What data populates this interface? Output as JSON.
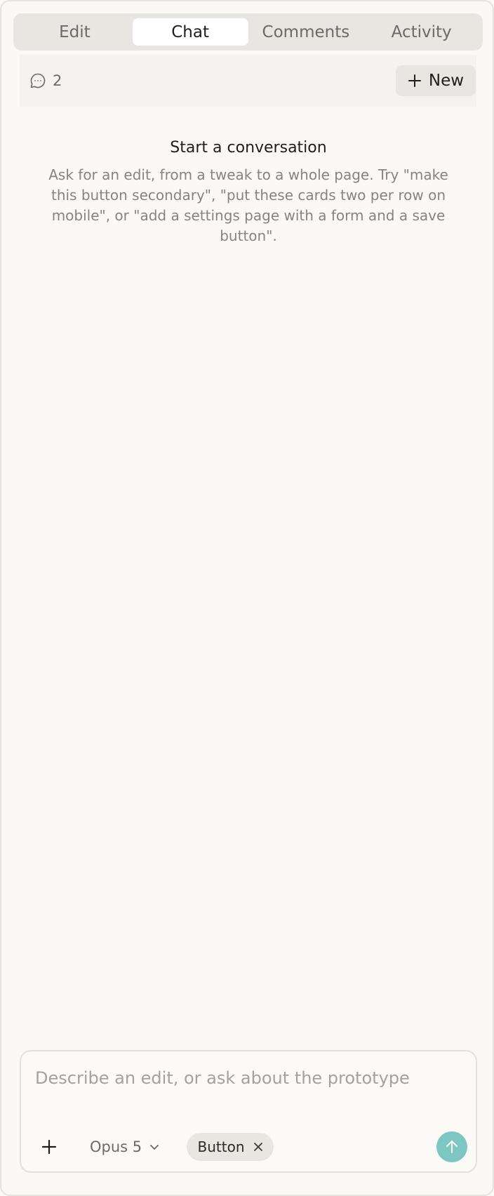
{
  "tabs": [
    {
      "label": "Edit",
      "active": false
    },
    {
      "label": "Chat",
      "active": true
    },
    {
      "label": "Comments",
      "active": false
    },
    {
      "label": "Activity",
      "active": false
    }
  ],
  "subheader": {
    "conversation_count": "2",
    "new_label": "New"
  },
  "empty_state": {
    "title": "Start a conversation",
    "body": "Ask for an edit, from a tweak to a whole page. Try \"make this button secondary\", \"put these cards two per row on mobile\", or \"add a settings page with a form and a save button\"."
  },
  "composer": {
    "placeholder": "Describe an edit, or ask about the prototype",
    "value": "",
    "model_label": "Opus 5",
    "chip_label": "Button"
  },
  "colors": {
    "accent": "#7ec6c1",
    "tab_bg": "#e8e6e0",
    "background": "#faf9f6"
  },
  "icons": {
    "count": "speech-bubble-icon",
    "new": "plus-icon",
    "attach": "plus-icon",
    "model": "chevron-down-icon",
    "chip_remove": "close-icon",
    "send": "arrow-up-icon"
  }
}
